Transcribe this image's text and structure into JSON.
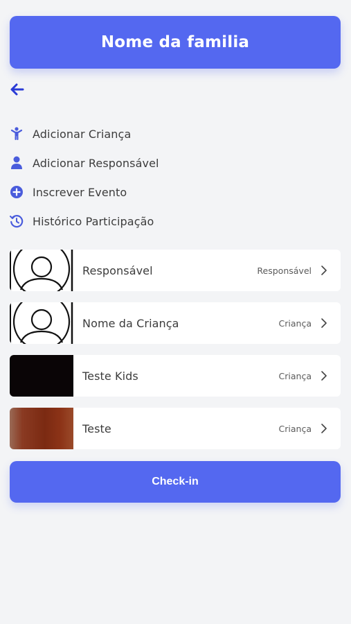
{
  "header": {
    "title": "Nome da familia"
  },
  "nav": {
    "back_icon": "arrow-left-icon"
  },
  "menu": [
    {
      "label": "Adicionar Criança",
      "icon": "child-icon"
    },
    {
      "label": "Adicionar Responsável",
      "icon": "user-icon"
    },
    {
      "label": "Inscrever Evento",
      "icon": "plus-circle-icon"
    },
    {
      "label": "Histórico Participação",
      "icon": "history-icon"
    }
  ],
  "members": [
    {
      "name": "Responsável",
      "role": "Responsável",
      "photo": "avatar-placeholder"
    },
    {
      "name": "Nome da Criança",
      "role": "Criança",
      "photo": "avatar-placeholder"
    },
    {
      "name": "Teste Kids",
      "role": "Criança",
      "photo": "dark-photo"
    },
    {
      "name": "Teste",
      "role": "Criança",
      "photo": "reddish-photo"
    }
  ],
  "actions": {
    "checkin_label": "Check-in"
  },
  "colors": {
    "accent": "#5468f0",
    "icon": "#4a5cdc",
    "background": "#f3f4f6"
  }
}
